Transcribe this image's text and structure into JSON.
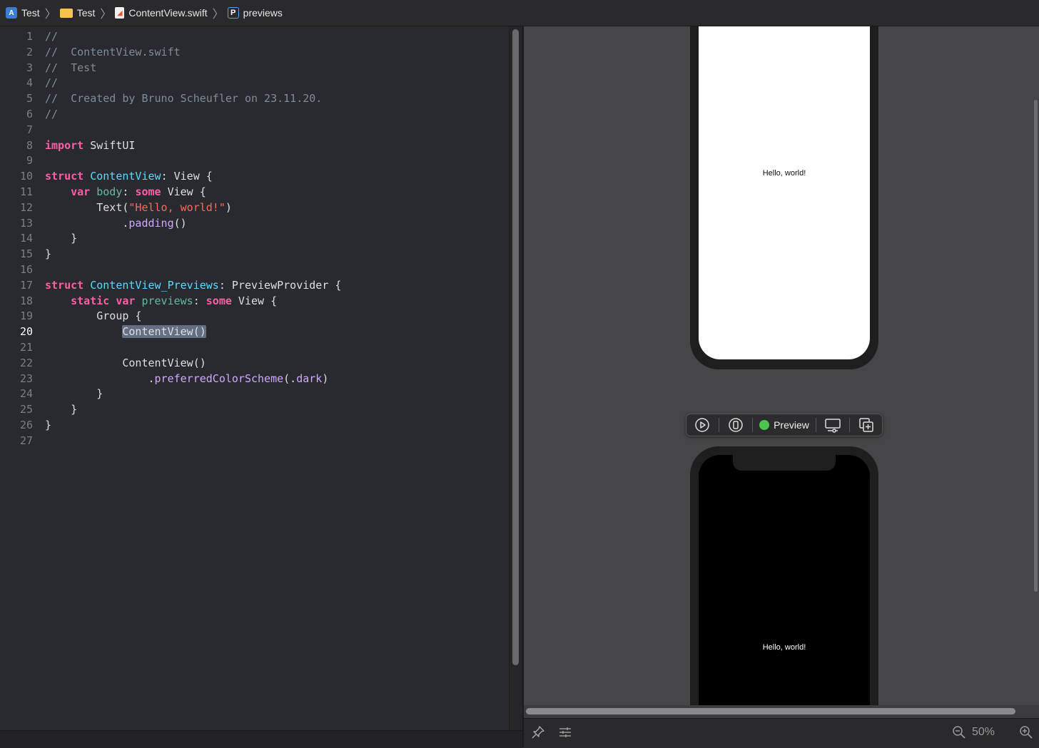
{
  "breadcrumb": [
    {
      "label": "Test",
      "icon": "project-icon"
    },
    {
      "label": "Test",
      "icon": "folder-icon"
    },
    {
      "label": "ContentView.swift",
      "icon": "swift-file-icon"
    },
    {
      "label": "previews",
      "icon": "property-icon"
    }
  ],
  "editor": {
    "current_line": 20,
    "line_numbers": [
      "1",
      "2",
      "3",
      "4",
      "5",
      "6",
      "7",
      "8",
      "9",
      "10",
      "11",
      "12",
      "13",
      "14",
      "15",
      "16",
      "17",
      "18",
      "19",
      "20",
      "21",
      "22",
      "23",
      "24",
      "25",
      "26",
      "27"
    ],
    "lines": [
      [
        {
          "t": "//",
          "c": "cm"
        }
      ],
      [
        {
          "t": "//  ContentView.swift",
          "c": "cm"
        }
      ],
      [
        {
          "t": "//  Test",
          "c": "cm"
        }
      ],
      [
        {
          "t": "//",
          "c": "cm"
        }
      ],
      [
        {
          "t": "//  Created by Bruno Scheufler on 23.11.20.",
          "c": "cm"
        }
      ],
      [
        {
          "t": "//",
          "c": "cm"
        }
      ],
      [],
      [
        {
          "t": "import",
          "c": "kw"
        },
        {
          "t": " SwiftUI",
          "c": "pl"
        }
      ],
      [],
      [
        {
          "t": "struct",
          "c": "kw"
        },
        {
          "t": " ",
          "c": "pl"
        },
        {
          "t": "ContentView",
          "c": "ty"
        },
        {
          "t": ": View {",
          "c": "pl"
        }
      ],
      [
        {
          "t": "    ",
          "c": "pl"
        },
        {
          "t": "var",
          "c": "kw"
        },
        {
          "t": " ",
          "c": "pl"
        },
        {
          "t": "body",
          "c": "fn2"
        },
        {
          "t": ": ",
          "c": "pl"
        },
        {
          "t": "some",
          "c": "kw"
        },
        {
          "t": " View {",
          "c": "pl"
        }
      ],
      [
        {
          "t": "        Text(",
          "c": "pl"
        },
        {
          "t": "\"Hello, world!\"",
          "c": "st"
        },
        {
          "t": ")",
          "c": "pl"
        }
      ],
      [
        {
          "t": "            .",
          "c": "pl"
        },
        {
          "t": "padding",
          "c": "sys"
        },
        {
          "t": "()",
          "c": "pl"
        }
      ],
      [
        {
          "t": "    }",
          "c": "pl"
        }
      ],
      [
        {
          "t": "}",
          "c": "pl"
        }
      ],
      [],
      [
        {
          "t": "struct",
          "c": "kw"
        },
        {
          "t": " ",
          "c": "pl"
        },
        {
          "t": "ContentView_Previews",
          "c": "ty"
        },
        {
          "t": ": PreviewProvider {",
          "c": "pl"
        }
      ],
      [
        {
          "t": "    ",
          "c": "pl"
        },
        {
          "t": "static",
          "c": "kw"
        },
        {
          "t": " ",
          "c": "pl"
        },
        {
          "t": "var",
          "c": "kw"
        },
        {
          "t": " ",
          "c": "pl"
        },
        {
          "t": "previews",
          "c": "fn2"
        },
        {
          "t": ": ",
          "c": "pl"
        },
        {
          "t": "some",
          "c": "kw"
        },
        {
          "t": " View {",
          "c": "pl"
        }
      ],
      [
        {
          "t": "        Group {",
          "c": "pl"
        }
      ],
      [
        {
          "t": "            ",
          "c": "pl"
        },
        {
          "t": "ContentView()",
          "c": "hl"
        }
      ],
      [],
      [
        {
          "t": "            ContentView()",
          "c": "pl"
        }
      ],
      [
        {
          "t": "                .",
          "c": "pl"
        },
        {
          "t": "preferredColorScheme",
          "c": "sys"
        },
        {
          "t": "(.",
          "c": "pl"
        },
        {
          "t": "dark",
          "c": "sys"
        },
        {
          "t": ")",
          "c": "pl"
        }
      ],
      [
        {
          "t": "        }",
          "c": "pl"
        }
      ],
      [
        {
          "t": "    }",
          "c": "pl"
        }
      ],
      [
        {
          "t": "}",
          "c": "pl"
        }
      ],
      []
    ]
  },
  "preview": {
    "light_text": "Hello, world!",
    "dark_text": "Hello, world!",
    "toolbar": {
      "live_icon": "play-circle-icon",
      "device_icon": "device-icon",
      "preview_label": "Preview",
      "status_color": "#4cc44e",
      "settings_icon": "display-settings-icon",
      "duplicate_icon": "duplicate-icon"
    }
  },
  "bottom": {
    "pin_icon": "pin-icon",
    "inspector_icon": "sliders-icon",
    "zoom_value": "50%",
    "zoom_out_icon": "zoom-out-icon",
    "zoom_in_icon": "zoom-in-icon"
  }
}
